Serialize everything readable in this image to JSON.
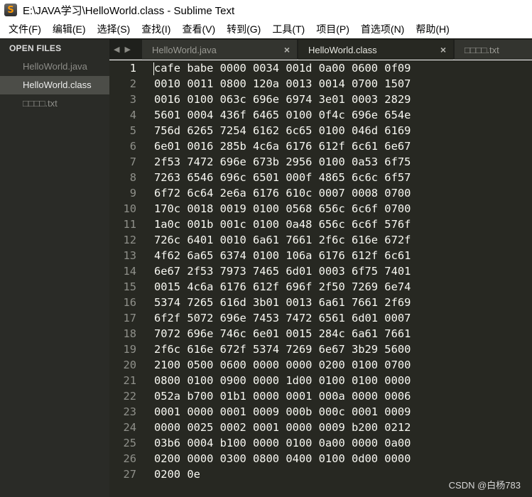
{
  "window": {
    "title": "E:\\JAVA学习\\HelloWorld.class - Sublime Text",
    "icon": "sublime-text-icon"
  },
  "menu": [
    "文件(F)",
    "编辑(E)",
    "选择(S)",
    "查找(I)",
    "查看(V)",
    "转到(G)",
    "工具(T)",
    "项目(P)",
    "首选项(N)",
    "帮助(H)"
  ],
  "sidebar": {
    "header": "OPEN FILES",
    "files": [
      {
        "label": "HelloWorld.java",
        "active": false
      },
      {
        "label": "HelloWorld.class",
        "active": true
      },
      {
        "label": "□□□□.txt",
        "active": false
      }
    ]
  },
  "tabs": [
    {
      "label": "HelloWorld.java",
      "close": "×",
      "active": false
    },
    {
      "label": "HelloWorld.class",
      "close": "×",
      "active": true
    },
    {
      "label": "□□□□.txt",
      "active": false
    }
  ],
  "nav": {
    "left": "◀",
    "right": "▶"
  },
  "editor": {
    "current_line": 1,
    "lines": [
      "cafe babe 0000 0034 001d 0a00 0600 0f09",
      "0010 0011 0800 120a 0013 0014 0700 1507",
      "0016 0100 063c 696e 6974 3e01 0003 2829",
      "5601 0004 436f 6465 0100 0f4c 696e 654e",
      "756d 6265 7254 6162 6c65 0100 046d 6169",
      "6e01 0016 285b 4c6a 6176 612f 6c61 6e67",
      "2f53 7472 696e 673b 2956 0100 0a53 6f75",
      "7263 6546 696c 6501 000f 4865 6c6c 6f57",
      "6f72 6c64 2e6a 6176 610c 0007 0008 0700",
      "170c 0018 0019 0100 0568 656c 6c6f 0700",
      "1a0c 001b 001c 0100 0a48 656c 6c6f 576f",
      "726c 6401 0010 6a61 7661 2f6c 616e 672f",
      "4f62 6a65 6374 0100 106a 6176 612f 6c61",
      "6e67 2f53 7973 7465 6d01 0003 6f75 7401",
      "0015 4c6a 6176 612f 696f 2f50 7269 6e74",
      "5374 7265 616d 3b01 0013 6a61 7661 2f69",
      "6f2f 5072 696e 7453 7472 6561 6d01 0007",
      "7072 696e 746c 6e01 0015 284c 6a61 7661",
      "2f6c 616e 672f 5374 7269 6e67 3b29 5600",
      "2100 0500 0600 0000 0000 0200 0100 0700",
      "0800 0100 0900 0000 1d00 0100 0100 0000",
      "052a b700 01b1 0000 0001 000a 0000 0006",
      "0001 0000 0001 0009 000b 000c 0001 0009",
      "0000 0025 0002 0001 0000 0009 b200 0212",
      "03b6 0004 b100 0000 0100 0a00 0000 0a00",
      "0200 0000 0300 0800 0400 0100 0d00 0000",
      "0200 0e"
    ]
  },
  "watermark": "CSDN @白杨783"
}
